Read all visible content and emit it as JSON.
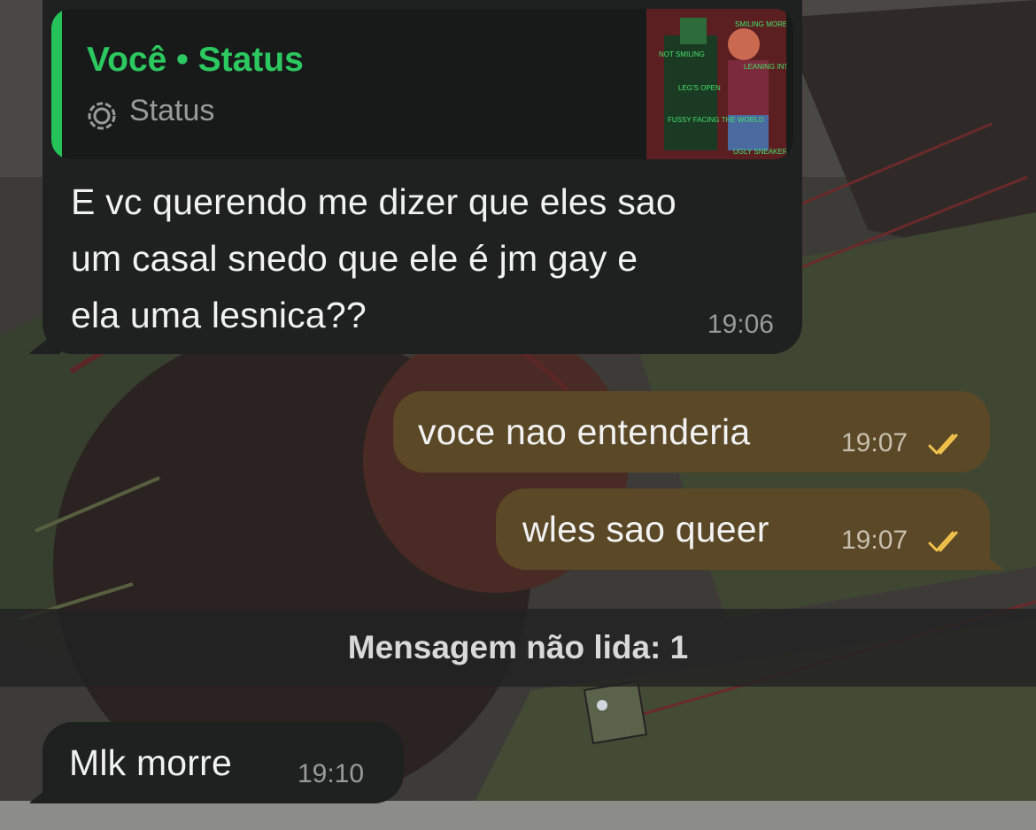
{
  "quote": {
    "title": "Você • Status",
    "subtitle": "Status",
    "thumb_caption_lines": [
      "NOT SMILING",
      "SMILING MORE THAN USUAL",
      "LEANING INTO HER",
      "LEG'S OPEN",
      "FUSSY FACING THE WORLD",
      "UGLY SNEAKERS"
    ]
  },
  "messages": [
    {
      "direction": "incoming",
      "lines": [
        "E vc querendo me dizer que eles sao",
        "um casal snedo que ele é jm gay e",
        "ela uma lesnica??"
      ],
      "time": "19:06"
    },
    {
      "direction": "outgoing",
      "text": "voce nao entenderia",
      "time": "19:07",
      "status": "read"
    },
    {
      "direction": "outgoing",
      "text": "wles sao queer",
      "time": "19:07",
      "status": "read"
    },
    {
      "direction": "incoming",
      "text": "Mlk morre",
      "time": "19:10"
    }
  ],
  "unread_banner": "Mensagem não lida: 1",
  "colors": {
    "incoming_bubble": "#1f2121",
    "outgoing_bubble": "#5a4826",
    "accent_green": "#2cc860",
    "read_ticks": "#f0c14b"
  },
  "icons": {
    "status": "status-ring-icon",
    "read_receipt": "double-check-icon"
  }
}
